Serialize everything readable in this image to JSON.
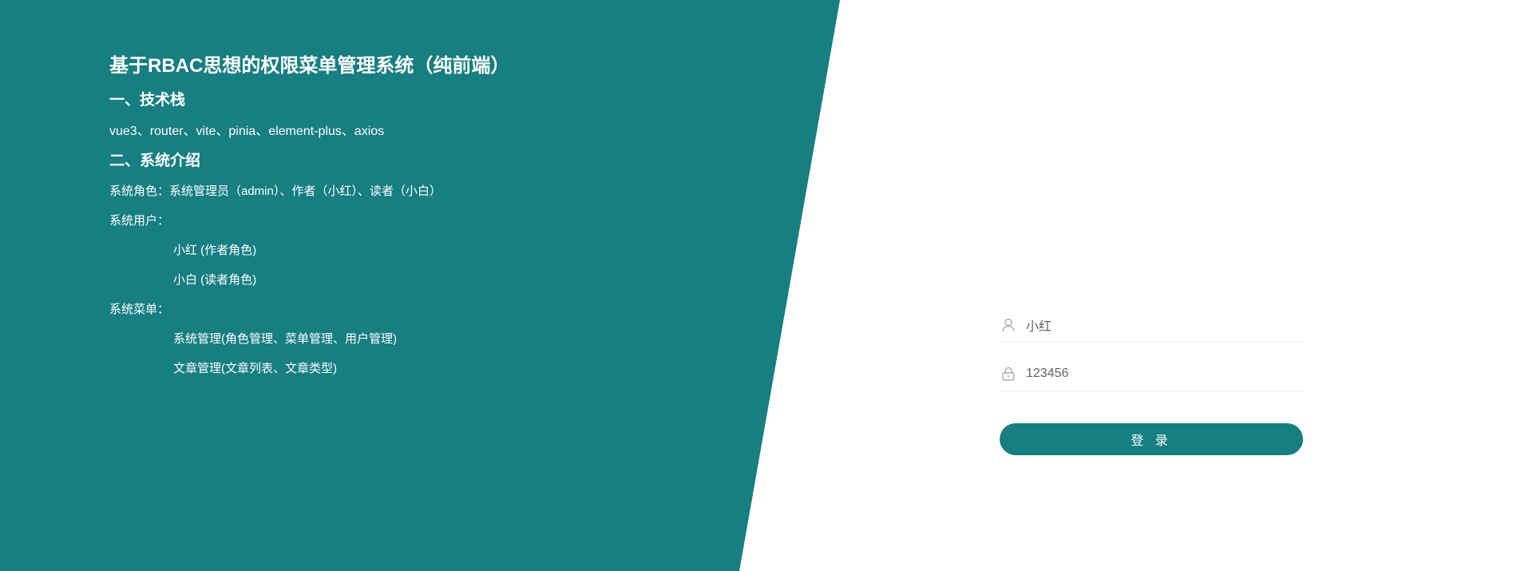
{
  "colors": {
    "primary": "#177e82",
    "background": "#ffffff",
    "text_light": "#ffffff",
    "input_text": "#606266",
    "icon": "#a8abb2"
  },
  "info": {
    "title": "基于RBAC思想的权限菜单管理系统（纯前端）",
    "tech_heading": "一、技术栈",
    "tech_stack": "vue3、router、vite、pinia、element-plus、axios",
    "intro_heading": "二、系统介绍",
    "roles_line": "系统角色：系统管理员（admin）、作者（小红）、读者（小白）",
    "users_label": "系统用户：",
    "users": [
      "小红 (作者角色)",
      "小白 (读者角色)"
    ],
    "menus_label": "系统菜单：",
    "menus": [
      "系统管理(角色管理、菜单管理、用户管理)",
      "文章管理(文章列表、文章类型)"
    ]
  },
  "login": {
    "username_icon": "user-icon",
    "username_value": "小红",
    "password_icon": "lock-icon",
    "password_value": "123456",
    "button_label": "登 录"
  }
}
